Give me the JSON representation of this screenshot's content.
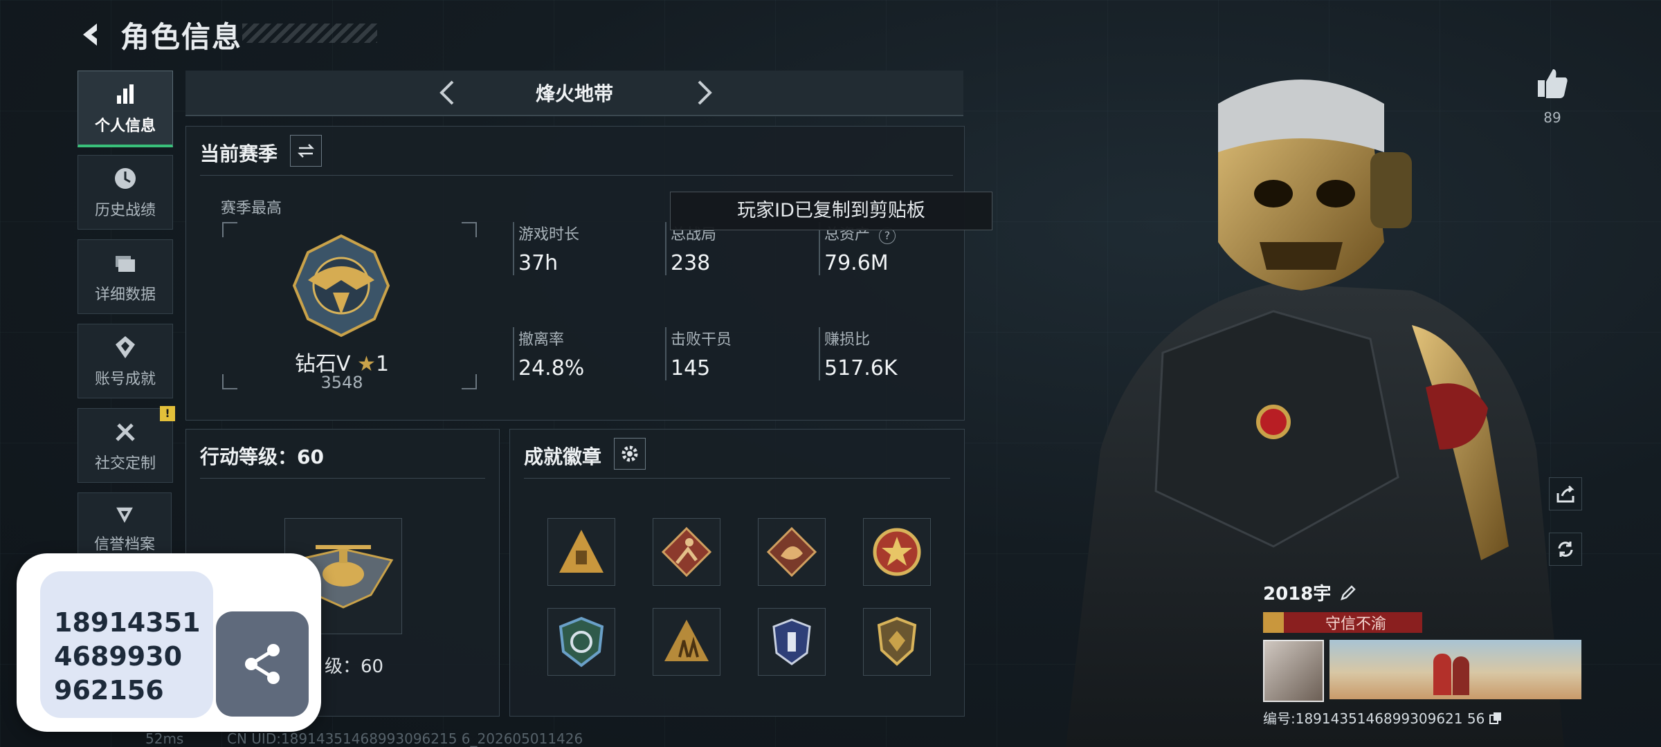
{
  "header": {
    "title": "角色信息"
  },
  "sidebar": {
    "items": [
      {
        "label": "个人信息",
        "icon": "bar-chart-icon"
      },
      {
        "label": "历史战绩",
        "icon": "history-icon"
      },
      {
        "label": "详细数据",
        "icon": "folder-icon"
      },
      {
        "label": "账号成就",
        "icon": "achievement-icon"
      },
      {
        "label": "社交定制",
        "icon": "tools-icon",
        "badge": "!"
      },
      {
        "label": "信誉档案",
        "icon": "credit-icon"
      }
    ]
  },
  "mode": {
    "title": "烽火地带"
  },
  "season": {
    "heading": "当前赛季",
    "best_label": "赛季最高",
    "rank_name": "钻石V",
    "rank_stars": "1",
    "rank_score": "3548",
    "stats": [
      {
        "label": "游戏时长",
        "value": "37h"
      },
      {
        "label": "总战局",
        "value": "238"
      },
      {
        "label": "总资产",
        "value": "79.6M"
      },
      {
        "label": "撤离率",
        "value": "24.8%"
      },
      {
        "label": "击败干员",
        "value": "145"
      },
      {
        "label": "赚损比",
        "value": "517.6K"
      }
    ]
  },
  "toast": {
    "text": "玩家ID已复制到剪贴板"
  },
  "action_level": {
    "heading": "行动等级：60",
    "level_text": "级：60"
  },
  "achievements": {
    "heading": "成就徽章"
  },
  "likes": {
    "count": "89"
  },
  "player": {
    "name": "2018宇",
    "title_tag": "守信不渝",
    "id_line": "编号:1891435146899309621 56"
  },
  "bubble": {
    "id_lines": [
      "18914351",
      "4689930",
      "962156"
    ]
  },
  "footer": {
    "ping": "52ms",
    "uid": "CN UID:18914351468993096215 6_202605011426"
  },
  "colors": {
    "accent_green": "#39c07a",
    "gold": "#c9a24a",
    "warn_yellow": "#e3c03a",
    "title_red": "#8a1f1f"
  }
}
